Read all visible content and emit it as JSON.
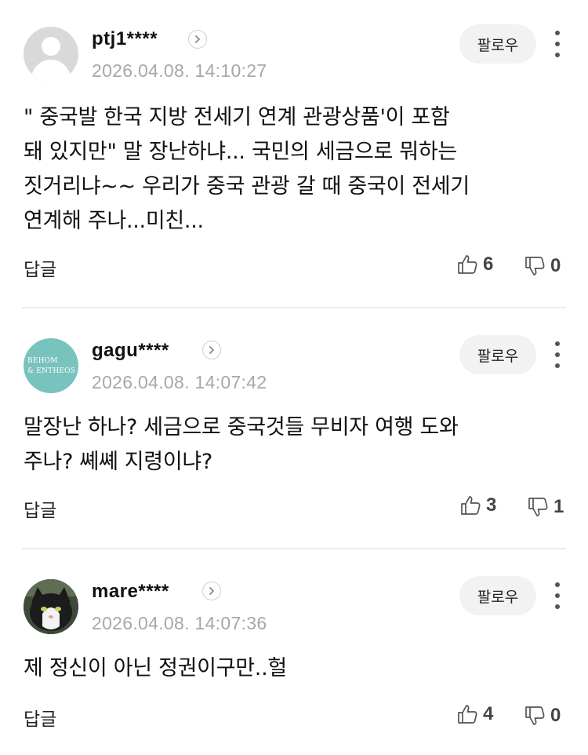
{
  "comments": [
    {
      "username": "ptj1****",
      "timestamp": "2026.04.08. 14:10:27",
      "avatar": "default-avatar",
      "follow_label": "팔로우",
      "text": "\" 중국발 한국 지방 전세기 연계 관광상품'이 포함\n돼 있지만\" 말 장난하냐... 국민의 세금으로 뭐하는\n짓거리냐~~ 우리가 중국 관광 갈 때 중국이 전세기\n연계해 주나...미친...",
      "reply_label": "답글",
      "likes": "6",
      "dislikes": "0"
    },
    {
      "username": "gagu****",
      "timestamp": "2026.04.08. 14:07:42",
      "avatar": "logo-avatar",
      "avatar_text": "BEHOM\n& ENTHEOS",
      "follow_label": "팔로우",
      "text": "말장난 하나? 세금으로 중국것들 무비자 여행 도와\n주나? 쎼쎼 지령이냐?",
      "reply_label": "답글",
      "likes": "3",
      "dislikes": "1"
    },
    {
      "username": "mare****",
      "timestamp": "2026.04.08. 14:07:36",
      "avatar": "cat-photo-avatar",
      "follow_label": "팔로우",
      "text": "제 정신이 아닌 정권이구만..헐",
      "reply_label": "답글",
      "likes": "4",
      "dislikes": "0"
    }
  ],
  "icons": {
    "profile": "chevron-right-icon",
    "more": "more-vertical-icon",
    "like": "thumbs-up-icon",
    "dislike": "thumbs-down-icon"
  },
  "colors": {
    "timestamp": "#a7a7a7",
    "follow_bg": "#f2f2f2",
    "divider": "#ececec",
    "teal_avatar": "#78c3bd"
  }
}
